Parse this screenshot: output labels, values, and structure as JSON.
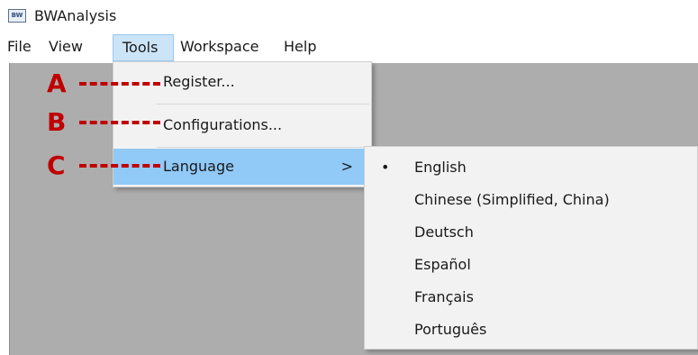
{
  "window": {
    "title": "BWAnalysis",
    "icon_text": "BW"
  },
  "menubar": {
    "items": [
      "File",
      "View",
      "Tools",
      "Workspace",
      "Help"
    ],
    "active": "Tools"
  },
  "tools_menu": {
    "items": [
      {
        "label": "Register...",
        "highlighted": false,
        "has_submenu": false
      },
      {
        "label": "Configurations...",
        "highlighted": false,
        "has_submenu": false
      },
      {
        "label": "Language",
        "highlighted": true,
        "has_submenu": true,
        "arrow": ">"
      }
    ]
  },
  "language_submenu": {
    "selected": "English",
    "bullet": "•",
    "items": [
      "English",
      "Chinese (Simplified, China)",
      "Deutsch",
      "Español",
      "Français",
      "Português"
    ]
  },
  "annotations": {
    "labels": [
      "A",
      "B",
      "C"
    ],
    "color": "#c00000"
  },
  "colors": {
    "workspace": "#adadad",
    "menu_bg": "#f2f2f2",
    "highlight": "#91c9f7",
    "active_menu": "#cce4f7"
  }
}
